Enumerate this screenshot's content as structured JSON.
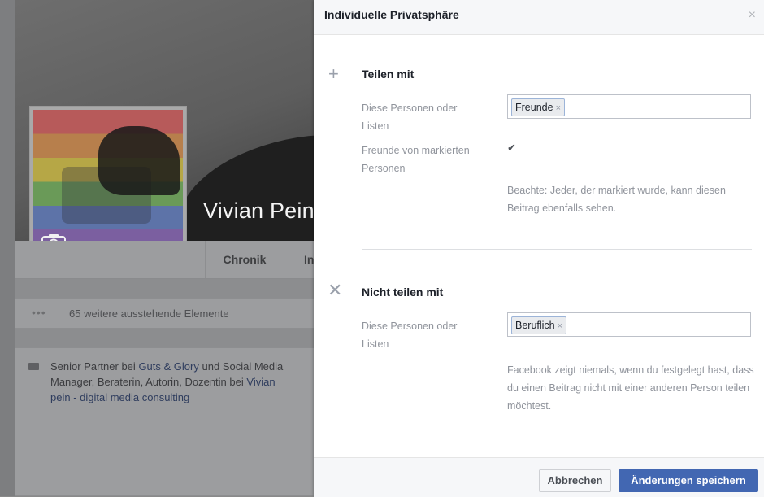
{
  "background": {
    "profile_name": "Vivian Pein",
    "nav_tabs": [
      "Chronik",
      "In"
    ],
    "pending_dots": "•••",
    "pending_text": "65 weitere ausstehende Elemente",
    "info": {
      "role": "Senior Partner",
      "bei1": "bei",
      "company1": "Guts & Glory",
      "und": "und",
      "role2": "Social Media Manager, Beraterin, Autorin, Dozentin",
      "bei2": "bei",
      "company2": "Vivian pein - digital media consulting"
    },
    "camera_icon": "camera-icon",
    "work_icon": "briefcase-icon"
  },
  "dialog": {
    "title": "Individuelle Privatsphäre",
    "close_glyph": "×",
    "share_section": {
      "icon": "plus-icon",
      "icon_glyph": "+",
      "title": "Teilen mit",
      "persons_label": "Diese Personen oder Listen",
      "token": "Freunde",
      "token_remove": "×",
      "tagged_friends_label": "Freunde von markierten Personen",
      "tagged_friends_checked": true,
      "check_glyph": "✔",
      "note": "Beachte: Jeder, der markiert wurde, kann diesen Beitrag ebenfalls sehen."
    },
    "noshare_section": {
      "icon": "cross-icon",
      "icon_glyph": "✕",
      "title": "Nicht teilen mit",
      "persons_label": "Diese Personen oder Listen",
      "token": "Beruflich",
      "token_remove": "×",
      "note": "Facebook zeigt niemals, wenn du festgelegt hast, dass du einen Beitrag nicht mit einer anderen Person teilen möchtest."
    },
    "footer": {
      "cancel_label": "Abbrechen",
      "save_label": "Änderungen speichern"
    }
  },
  "colors": {
    "primary_button": "#4267b2",
    "token_border": "#9cb4d8",
    "muted_text": "#90949c"
  }
}
